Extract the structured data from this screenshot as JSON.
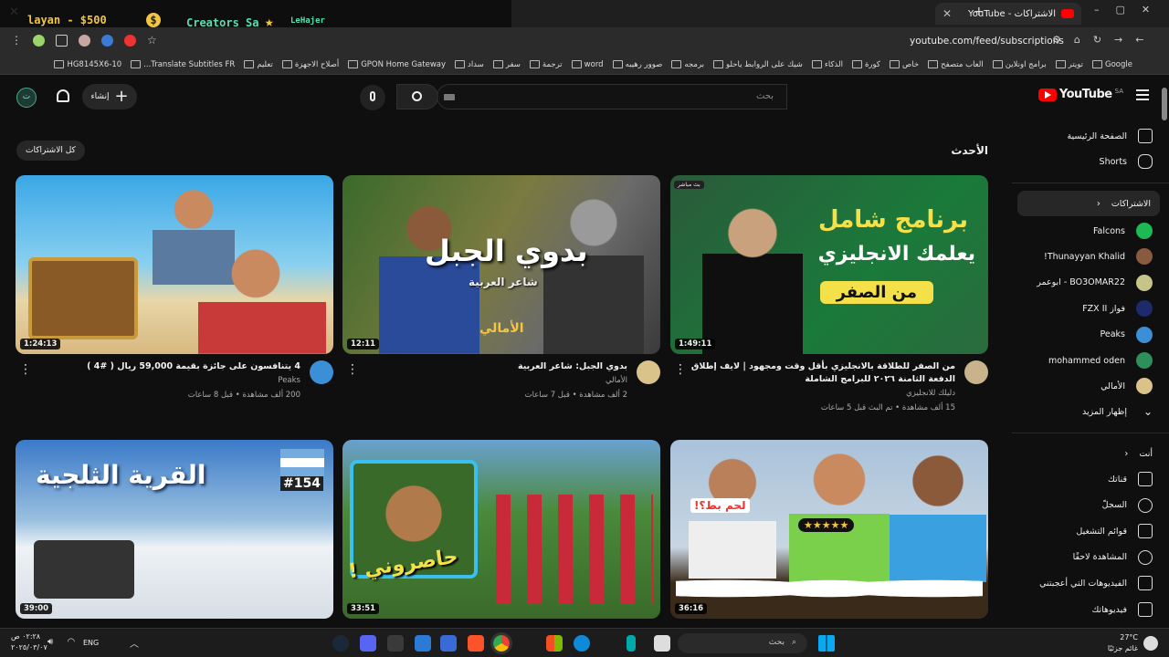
{
  "browser": {
    "tab_title": "الاشتراكات - YouTube",
    "url": "youtube.com/feed/subscriptions",
    "bookmarks": [
      "Google",
      "تويتر",
      "برامج اونلاين",
      "العاب متصفح",
      "خاص",
      "كورة",
      "الذكاء",
      "شيك على الروابط ياحلو",
      "برمجه",
      "صوور رهيبه",
      "word",
      "ترجمة",
      "سفر",
      "سداد",
      "GPON Home Gateway",
      "أصلاح الاجهزة",
      "تعليم",
      "Translate Subtitles FR...",
      "HG8145X6-10"
    ]
  },
  "overlay": {
    "balance": "layan - $500",
    "dollar": "$",
    "channel": "Creators Sa -",
    "star": "★",
    "name": "LeHajer"
  },
  "header": {
    "logo": "YouTube",
    "region": "SA",
    "search_placeholder": "بحث",
    "create_label": "إنشاء",
    "avatar_letter": "ت"
  },
  "sidebar": {
    "home": "الصفحة الرئيسية",
    "shorts": "Shorts",
    "subscriptions": "الاشتراكات",
    "channels": [
      {
        "name": "Falcons",
        "color": "#1db954"
      },
      {
        "name": "Thunayyan Khalid!",
        "color": "#8a5a40"
      },
      {
        "name": "BO3OMAR22 - ابوعمر",
        "color": "#c7c48a"
      },
      {
        "name": "فواز FZX II",
        "color": "#1d2a6b"
      },
      {
        "name": "Peaks",
        "color": "#3b8fd6"
      },
      {
        "name": "mohammed oden",
        "color": "#2f8f5a"
      },
      {
        "name": "الأمالي",
        "color": "#d9c38a"
      }
    ],
    "show_more": "إظهار المزيد",
    "you": "أنت",
    "you_items": [
      "قناتك",
      "السجلّ",
      "قوائم التشغيل",
      "المشاهدة لاحقًا",
      "الفيديوهات التي أعجبتني",
      "فيديوهاتك"
    ]
  },
  "feed": {
    "section_title": "الأحدث",
    "all_subs": "كل الاشتراكات",
    "videos": [
      {
        "title": "من الصفر للطلاقة بالانجليزي بأقل وقت ومجهود | لايف إطلاق الدفعة الثامنة ٢٠٢٦ للبرامج الشاملة",
        "channel": "دليلك للانجليزي",
        "stats": "15 ألف مشاهدة • تم البث قبل 5 ساعات",
        "duration": "1:49:11",
        "live_badge": "بث مباشر",
        "thumb_lines": [
          "برنامج شامل",
          "يعلمك الانجليزي",
          "من الصفر"
        ],
        "avatar_color": "#c9b38a"
      },
      {
        "title": "بدوي الجبل: شاعر العربية",
        "channel": "الأمالي",
        "stats": "2 ألف مشاهدة • قبل 7 ساعات",
        "duration": "12:11",
        "thumb_lines": [
          "بدوي الجبل",
          "شاعر العربية",
          "الأمالي"
        ],
        "avatar_color": "#d9c38a"
      },
      {
        "title": "4 يتنافسون على جائزة بقيمة 59,000 ريال ( #4 )",
        "channel": "Peaks",
        "stats": "200 ألف مشاهدة • قبل 8 ساعات",
        "duration": "1:24:13",
        "thumb_lines": [],
        "avatar_color": "#3b8fd6"
      },
      {
        "title": "",
        "channel": "",
        "stats": "",
        "duration": "36:16",
        "thumb_lines": [
          "لحم بط؟!"
        ],
        "avatar_color": "#2f8f5a"
      },
      {
        "title": "",
        "channel": "",
        "stats": "",
        "duration": "33:51",
        "thumb_lines": [
          "حاصروني !"
        ],
        "avatar_color": "#555"
      },
      {
        "title": "",
        "channel": "",
        "stats": "",
        "duration": "39:00",
        "thumb_lines": [
          "القرية الثلجية",
          "#154"
        ],
        "avatar_color": "#555"
      }
    ]
  },
  "taskbar": {
    "time": "٠٢:٢٨ ص",
    "date": "٢٠٢٥/٠٣/٠٧",
    "lang": "ENG",
    "search": "بحث",
    "weather_temp": "27°C",
    "weather_desc": "غائم جزئيًا"
  }
}
